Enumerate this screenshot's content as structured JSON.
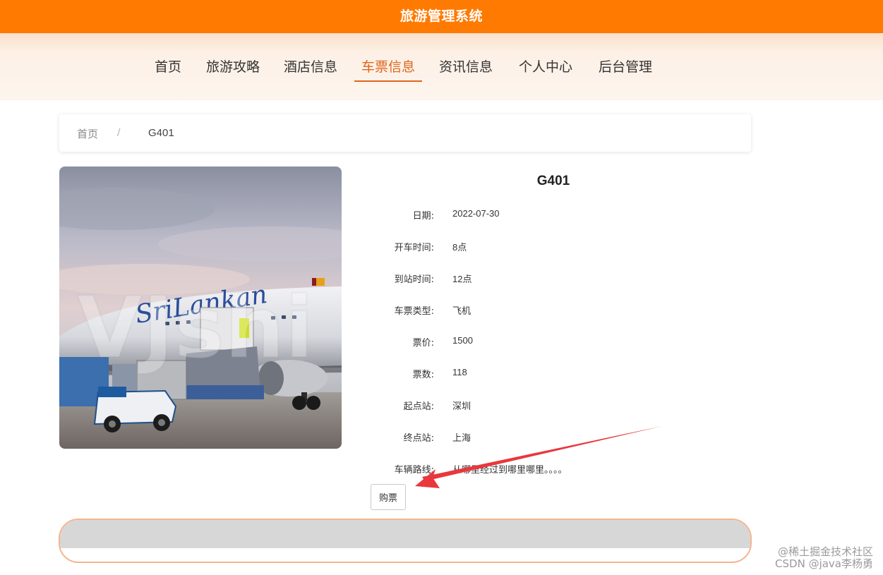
{
  "header": {
    "title": "旅游管理系统"
  },
  "nav": {
    "items": [
      {
        "label": "首页"
      },
      {
        "label": "旅游攻略"
      },
      {
        "label": "酒店信息"
      },
      {
        "label": "车票信息",
        "active": true
      },
      {
        "label": "资讯信息"
      },
      {
        "label": "个人中心"
      },
      {
        "label": "后台管理"
      }
    ]
  },
  "breadcrumb": {
    "home": "首页",
    "separator": "/",
    "current": "G401"
  },
  "ticket": {
    "title": "G401",
    "fields": [
      {
        "label": "日期:",
        "value": "2022-07-30"
      },
      {
        "label": "开车时间:",
        "value": "8点"
      },
      {
        "label": "到站时间:",
        "value": "12点"
      },
      {
        "label": "车票类型:",
        "value": "飞机"
      },
      {
        "label": "票价:",
        "value": "1500"
      },
      {
        "label": "票数:",
        "value": "118"
      },
      {
        "label": "起点站:",
        "value": "深圳"
      },
      {
        "label": "终点站:",
        "value": "上海"
      },
      {
        "label": "车辆路线:",
        "value": "从哪里经过到哪里哪里。。。。"
      }
    ],
    "buy_label": "购票"
  },
  "photo": {
    "watermark_text": "VJshi",
    "airline_text": "SriLankan"
  },
  "watermarks": {
    "line1": "@稀土掘金技术社区",
    "line2": "CSDN @java李杨勇"
  },
  "colors": {
    "brand": "#ff7a00",
    "active": "#e0661c",
    "arrow": "#e8383d"
  }
}
